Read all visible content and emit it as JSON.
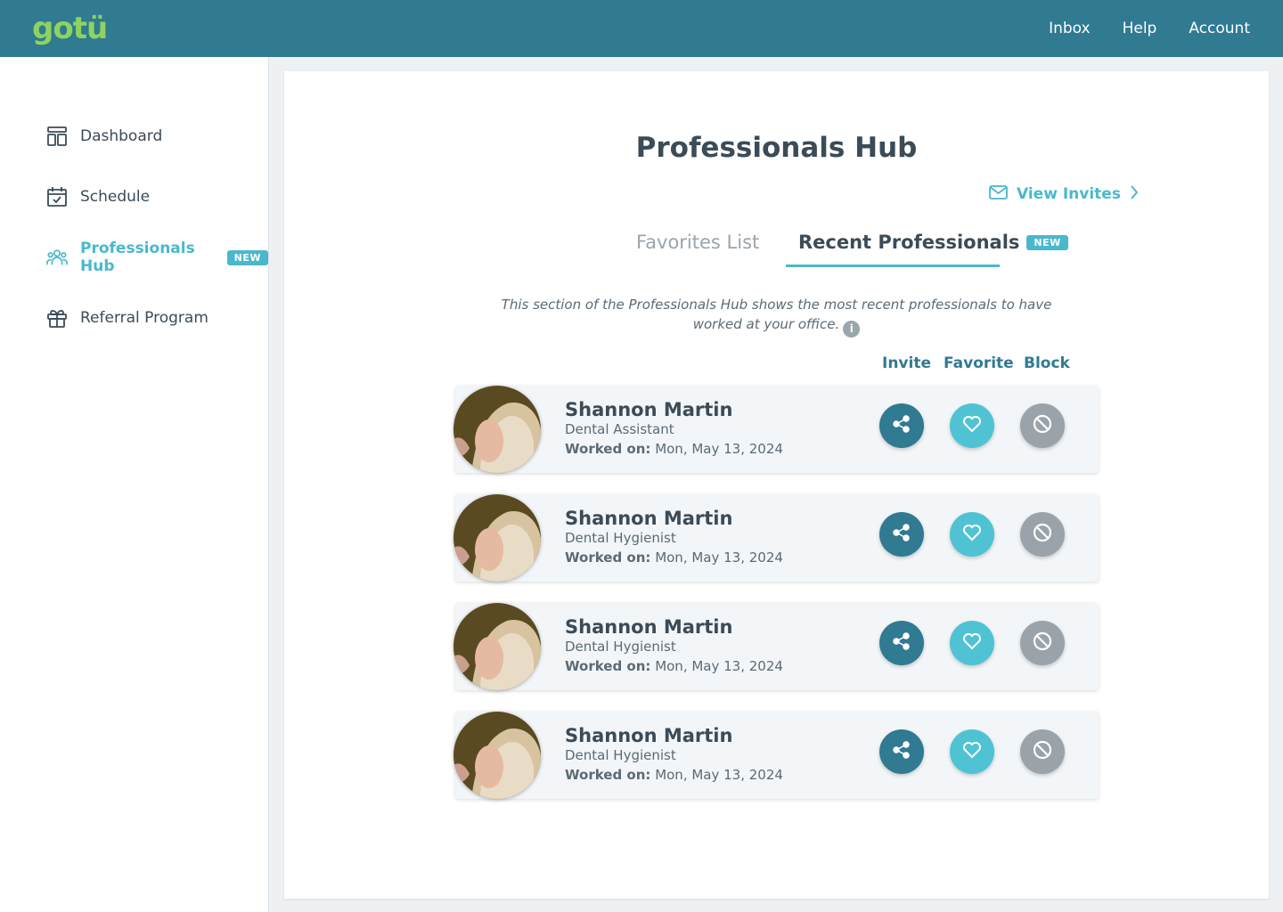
{
  "header": {
    "logo": "gotü",
    "nav": [
      "Inbox",
      "Help",
      "Account"
    ]
  },
  "sidebar": {
    "items": [
      {
        "label": "Dashboard",
        "icon": "dashboard-icon"
      },
      {
        "label": "Schedule",
        "icon": "calendar-icon"
      },
      {
        "label": "Professionals Hub",
        "icon": "users-icon",
        "badge": "NEW",
        "active": true
      },
      {
        "label": "Referral Program",
        "icon": "gift-icon"
      }
    ]
  },
  "main": {
    "title": "Professionals Hub",
    "view_invites": "View Invites",
    "tabs": [
      {
        "label": "Favorites List"
      },
      {
        "label": "Recent Professionals",
        "badge": "NEW",
        "active": true
      }
    ],
    "description": "This section of the Professionals Hub shows the most recent professionals to have worked at your office.",
    "columns": [
      "Invite",
      "Favorite",
      "Block"
    ],
    "worked_label": "Worked on:",
    "professionals": [
      {
        "name": "Shannon Martin",
        "role": "Dental Assistant",
        "worked_on": "Mon, May 13, 2024"
      },
      {
        "name": "Shannon Martin",
        "role": "Dental Hygienist",
        "worked_on": "Mon, May 13, 2024"
      },
      {
        "name": "Shannon Martin",
        "role": "Dental Hygienist",
        "worked_on": "Mon, May 13, 2024"
      },
      {
        "name": "Shannon Martin",
        "role": "Dental Hygienist",
        "worked_on": "Mon, May 13, 2024"
      }
    ]
  },
  "colors": {
    "header_bg": "#307a92",
    "accent": "#4ab8cc",
    "logo_green": "#8fd35f",
    "invite_btn": "#307a92",
    "favorite_btn": "#4fc3d3",
    "block_btn": "#9aa3a9"
  }
}
